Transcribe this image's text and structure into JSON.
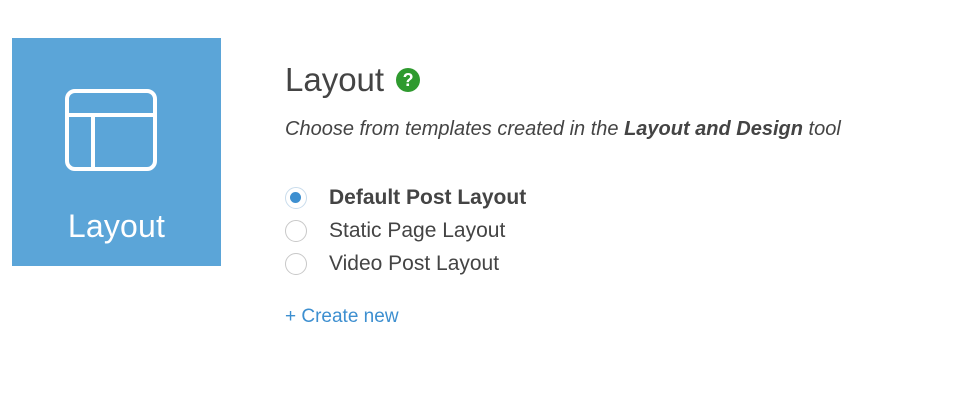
{
  "tile": {
    "icon": "layout-template-icon",
    "label": "Layout",
    "color": "#5ba5d8"
  },
  "header": {
    "title": "Layout",
    "help_icon": "question-mark-icon",
    "help_glyph": "?",
    "help_color": "#2f9a2f"
  },
  "subtitle": {
    "prefix": "Choose from templates created in the ",
    "emphasis": "Layout and Design",
    "suffix": " tool"
  },
  "layout_options": [
    {
      "label": "Default Post Layout",
      "selected": true
    },
    {
      "label": "Static Page Layout",
      "selected": false
    },
    {
      "label": "Video Post Layout",
      "selected": false
    }
  ],
  "create_link": {
    "label": "+ Create new",
    "color": "#3d8fd0"
  }
}
